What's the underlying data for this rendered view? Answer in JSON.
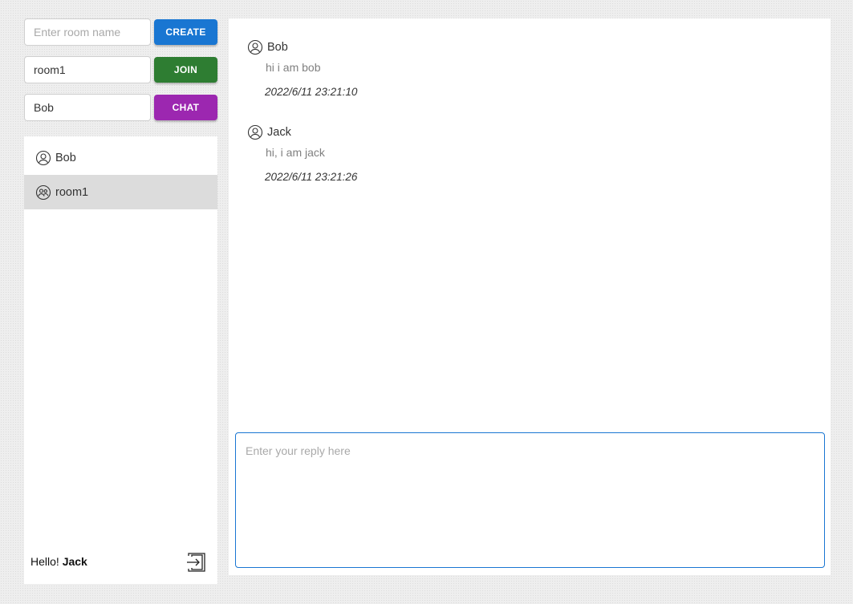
{
  "controls": {
    "room_name_placeholder": "Enter room name",
    "create_label": "CREATE",
    "join_value": "room1",
    "join_label": "JOIN",
    "chat_value": "Bob",
    "chat_label": "CHAT"
  },
  "sidebar": {
    "items": [
      {
        "label": "Bob",
        "icon": "user-icon",
        "selected": false
      },
      {
        "label": "room1",
        "icon": "group-icon",
        "selected": true
      }
    ],
    "greeting_prefix": "Hello!",
    "greeting_name": "Jack",
    "logout_icon": "logout-icon"
  },
  "messages": [
    {
      "sender": "Bob",
      "text": "hi i am bob",
      "time": "2022/6/11 23:21:10"
    },
    {
      "sender": "Jack",
      "text": "hi, i am jack",
      "time": "2022/6/11 23:21:26"
    }
  ],
  "reply": {
    "placeholder": "Enter your reply here"
  },
  "colors": {
    "create": "#1976d2",
    "join": "#2e7d32",
    "chat": "#9c27b0",
    "selected_row": "#dcdcdc",
    "reply_border": "#1976d2"
  }
}
